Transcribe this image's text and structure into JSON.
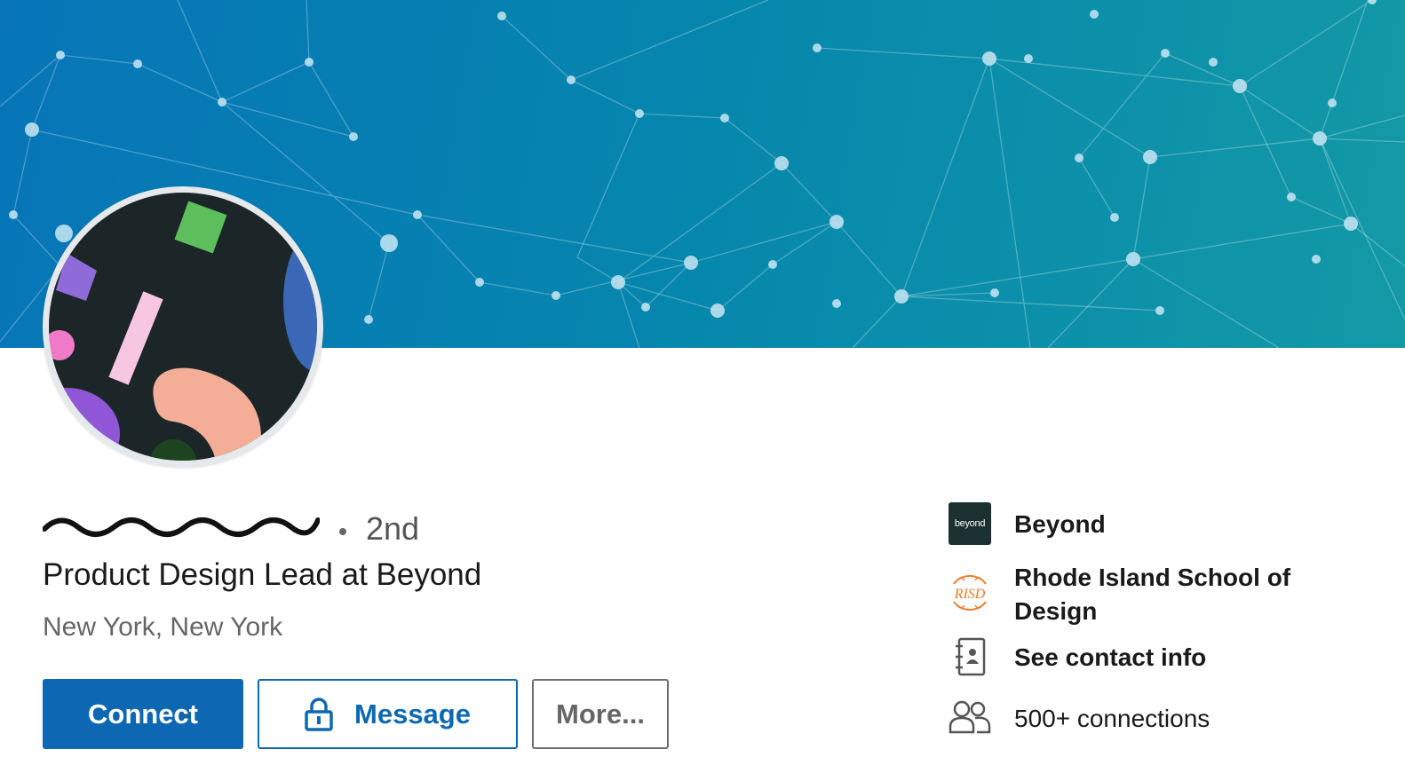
{
  "profile": {
    "degree": "2nd",
    "headline": "Product Design Lead at Beyond",
    "location": "New York, New York"
  },
  "actions": {
    "connect_label": "Connect",
    "message_label": "Message",
    "more_label": "More..."
  },
  "sidebar": {
    "company": {
      "name": "Beyond",
      "logo_text": "beyond"
    },
    "school": {
      "name": "Rhode Island School of Design",
      "logo_text": "RISD"
    },
    "contact_label": "See contact info",
    "connections_label": "500+ connections"
  },
  "colors": {
    "brand_blue": "#0e67b2",
    "banner_start": "#0775b8",
    "banner_end": "#1399a6"
  }
}
